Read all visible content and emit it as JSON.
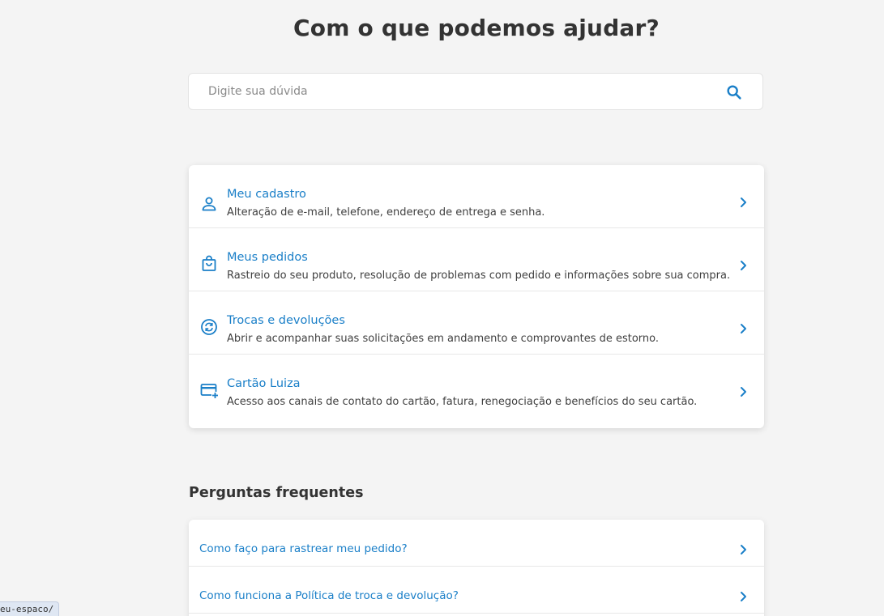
{
  "header": {
    "title": "Com o que podemos ajudar?"
  },
  "search": {
    "placeholder": "Digite sua dúvida",
    "icon": "search-icon"
  },
  "colors": {
    "accent": "#1a7fc8",
    "background": "#f4f4f4"
  },
  "topics": [
    {
      "title": "Meu cadastro",
      "description": "Alteração de e-mail, telefone, endereço de entrega e senha.",
      "icon": "person-icon"
    },
    {
      "title": "Meus pedidos",
      "description": "Rastreio do seu produto, resolução de problemas com pedido e informações sobre sua compra.",
      "icon": "shopping-bag-icon"
    },
    {
      "title": "Trocas e devoluções",
      "description": "Abrir e acompanhar suas solicitações em andamento e comprovantes de estorno.",
      "icon": "exchange-icon"
    },
    {
      "title": "Cartão Luiza",
      "description": "Acesso aos canais de contato do cartão, fatura, renegociação e benefícios do seu cartão.",
      "icon": "credit-card-add-icon"
    }
  ],
  "faq": {
    "heading": "Perguntas frequentes",
    "items": [
      {
        "question": "Como faço para rastrear meu pedido?"
      },
      {
        "question": "Como funciona a Política de troca e devolução?"
      }
    ]
  },
  "status_bar": {
    "url": "eu-espaco/"
  }
}
